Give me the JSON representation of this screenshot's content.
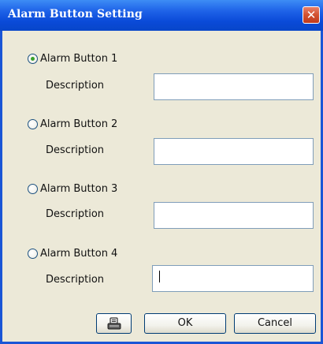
{
  "window": {
    "title": "Alarm Button Setting",
    "close_glyph": "✕"
  },
  "alarm_buttons": [
    {
      "label": "Alarm Button 1",
      "selected": true,
      "description_label": "Description",
      "description_value": ""
    },
    {
      "label": "Alarm Button 2",
      "selected": false,
      "description_label": "Description",
      "description_value": ""
    },
    {
      "label": "Alarm Button 3",
      "selected": false,
      "description_label": "Description",
      "description_value": ""
    },
    {
      "label": "Alarm Button 4",
      "selected": false,
      "description_label": "Description",
      "description_value": ""
    }
  ],
  "footer": {
    "icon_button": "sound-icon",
    "ok_label": "OK",
    "cancel_label": "Cancel"
  },
  "colors": {
    "titlebar": "#0a4ad8",
    "close_button": "#d2512f",
    "dialog_background": "#ece9d8",
    "radio_dot": "#3aa12b"
  }
}
